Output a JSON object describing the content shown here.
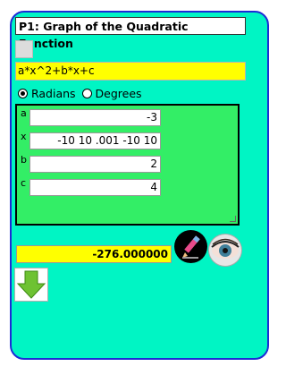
{
  "title": "P1: Graph of the Quadratic Function",
  "formula": "a*x^2+b*x+c",
  "angle_mode": {
    "options": [
      "Radians",
      "Degrees"
    ],
    "selected": "Radians"
  },
  "variables": [
    {
      "name": "a",
      "value": "-3"
    },
    {
      "name": "x",
      "value": "-10 10 .001 -10 10"
    },
    {
      "name": "b",
      "value": "2"
    },
    {
      "name": "c",
      "value": "4"
    }
  ],
  "result": "-276.000000",
  "icons": {
    "pen": "pen-icon",
    "eye": "eye-icon",
    "down": "down-arrow-icon"
  },
  "colors": {
    "panel": "#00f5c4",
    "panel_border": "#1d2bd6",
    "highlight": "#ffff00",
    "vars_bg": "#33ee66"
  }
}
